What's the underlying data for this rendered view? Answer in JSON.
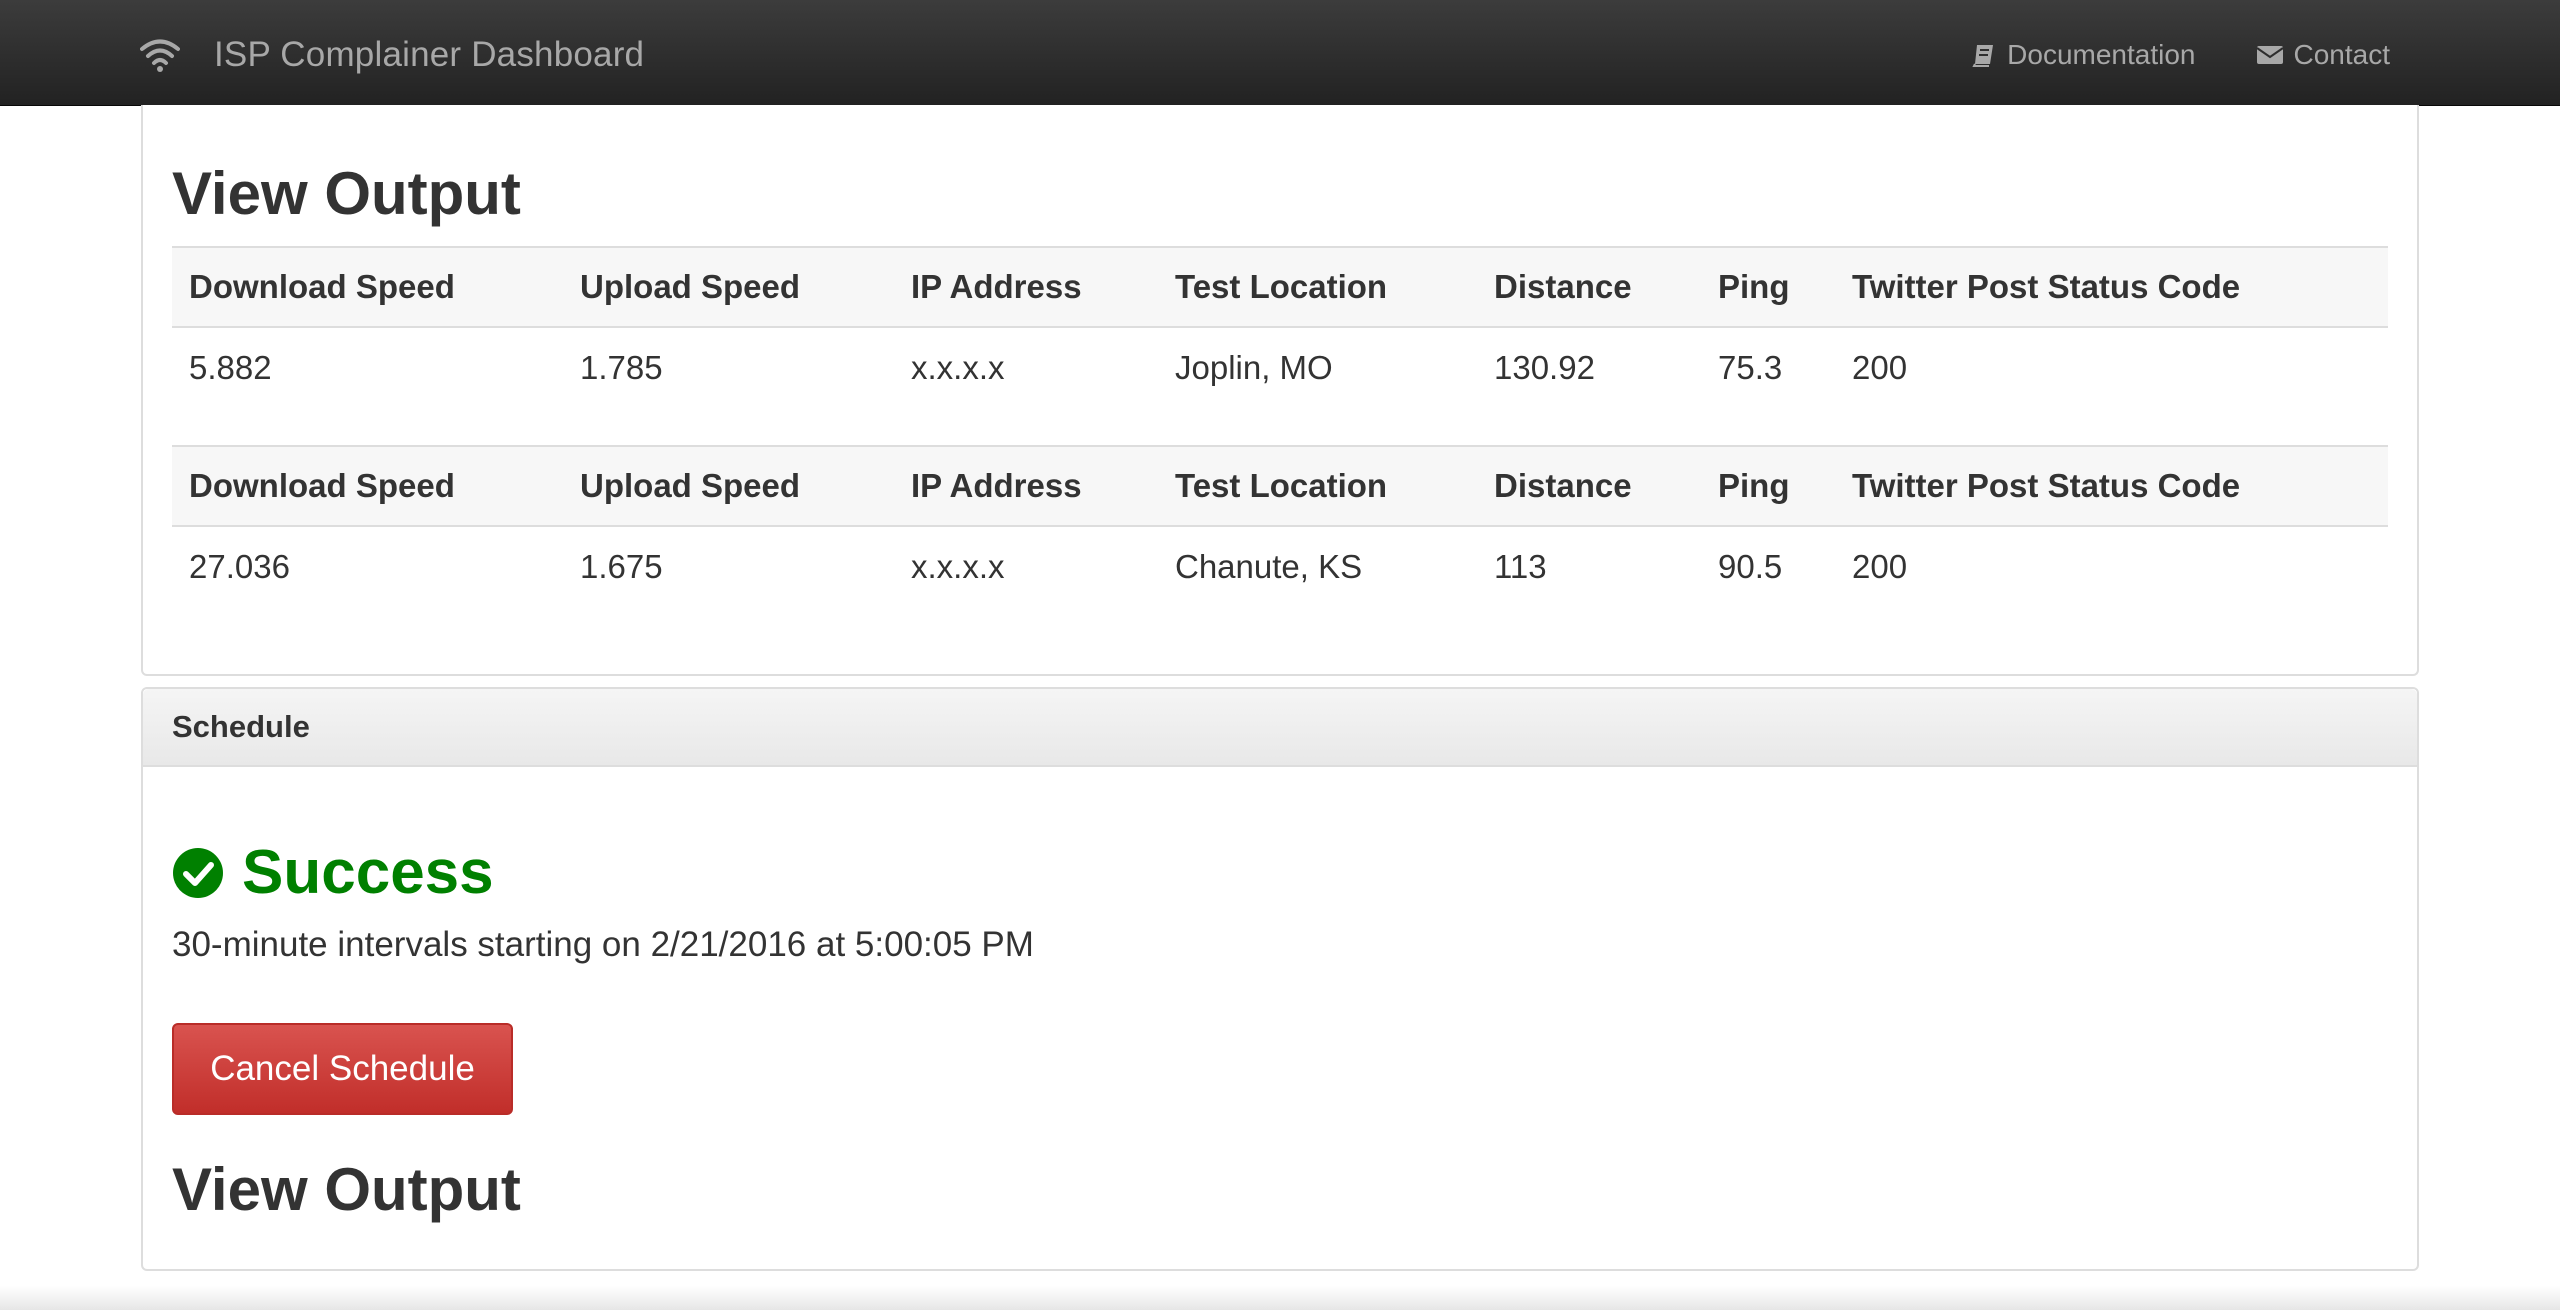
{
  "navbar": {
    "icon": "wifi-icon",
    "title": "ISP Complainer Dashboard",
    "links": [
      {
        "label": "Documentation",
        "icon": "book-icon"
      },
      {
        "label": "Contact",
        "icon": "envelope-icon"
      }
    ]
  },
  "output_panel": {
    "heading": "View Output",
    "columns": [
      "Download Speed",
      "Upload Speed",
      "IP Address",
      "Test Location",
      "Distance",
      "Ping",
      "Twitter Post Status Code"
    ],
    "results": [
      {
        "download": "5.882",
        "upload": "1.785",
        "ip": "x.x.x.x",
        "location": "Joplin, MO",
        "distance": "130.92",
        "ping": "75.3",
        "status": "200"
      },
      {
        "download": "27.036",
        "upload": "1.675",
        "ip": "x.x.x.x",
        "location": "Chanute, KS",
        "distance": "113",
        "ping": "90.5",
        "status": "200"
      }
    ]
  },
  "schedule_panel": {
    "title": "Schedule",
    "status": "Success",
    "status_icon": "check-circle-icon",
    "status_color": "#008000",
    "message": "30-minute intervals starting on 2/21/2016 at 5:00:05 PM",
    "cancel_label": "Cancel Schedule",
    "cancel_color": "#d9534f",
    "output_heading": "View Output"
  }
}
